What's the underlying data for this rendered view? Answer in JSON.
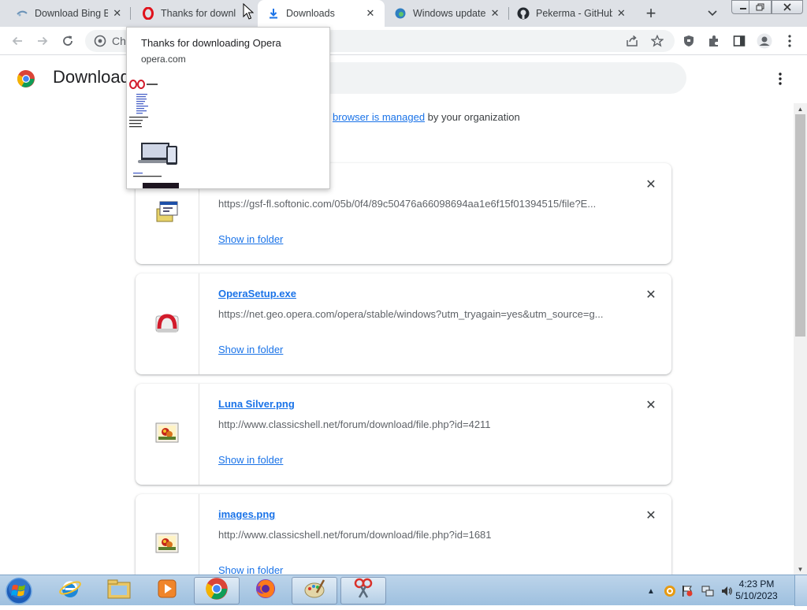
{
  "tabs": [
    {
      "title": "Download Bing Ba",
      "icon": "bing-icon",
      "active": false
    },
    {
      "title": "Thanks for downl",
      "icon": "opera-icon",
      "active": false
    },
    {
      "title": "Downloads",
      "icon": "download-icon",
      "active": true
    },
    {
      "title": "Windows update",
      "icon": "edge-icon",
      "active": false
    },
    {
      "title": "Pekerma - GitHub",
      "icon": "github-icon",
      "active": false
    }
  ],
  "toolbar": {
    "omnibox_text": "Chr"
  },
  "page": {
    "title": "Download",
    "managed_link": "browser is managed",
    "managed_suffix": " by your organization"
  },
  "downloads": [
    {
      "filename": "",
      "url": "https://gsf-fl.softonic.com/05b/0f4/89c50476a66098694aa1e6f15f01394515/file?E...",
      "action": "Show in folder",
      "icon": "installer-icon"
    },
    {
      "filename": "OperaSetup.exe",
      "url": "https://net.geo.opera.com/opera/stable/windows?utm_tryagain=yes&utm_source=g...",
      "action": "Show in folder",
      "icon": "opera-installer-icon"
    },
    {
      "filename": "Luna Silver.png",
      "url": "http://www.classicshell.net/forum/download/file.php?id=4211",
      "action": "Show in folder",
      "icon": "image-file-icon"
    },
    {
      "filename": "images.png",
      "url": "http://www.classicshell.net/forum/download/file.php?id=1681",
      "action": "Show in folder",
      "icon": "image-file-icon"
    }
  ],
  "hovercard": {
    "title": "Thanks for downloading Opera",
    "domain": "opera.com"
  },
  "taskbar": {
    "apps": [
      "internet-explorer-icon",
      "windows-explorer-icon",
      "media-player-icon",
      "chrome-icon",
      "firefox-icon",
      "paint-icon",
      "snipping-tool-icon"
    ],
    "time": "4:23 PM",
    "date": "5/10/2023"
  },
  "colors": {
    "accent": "#1a73e8",
    "tabstrip": "#dee1e6",
    "taskbar": "#a9c7e4"
  }
}
